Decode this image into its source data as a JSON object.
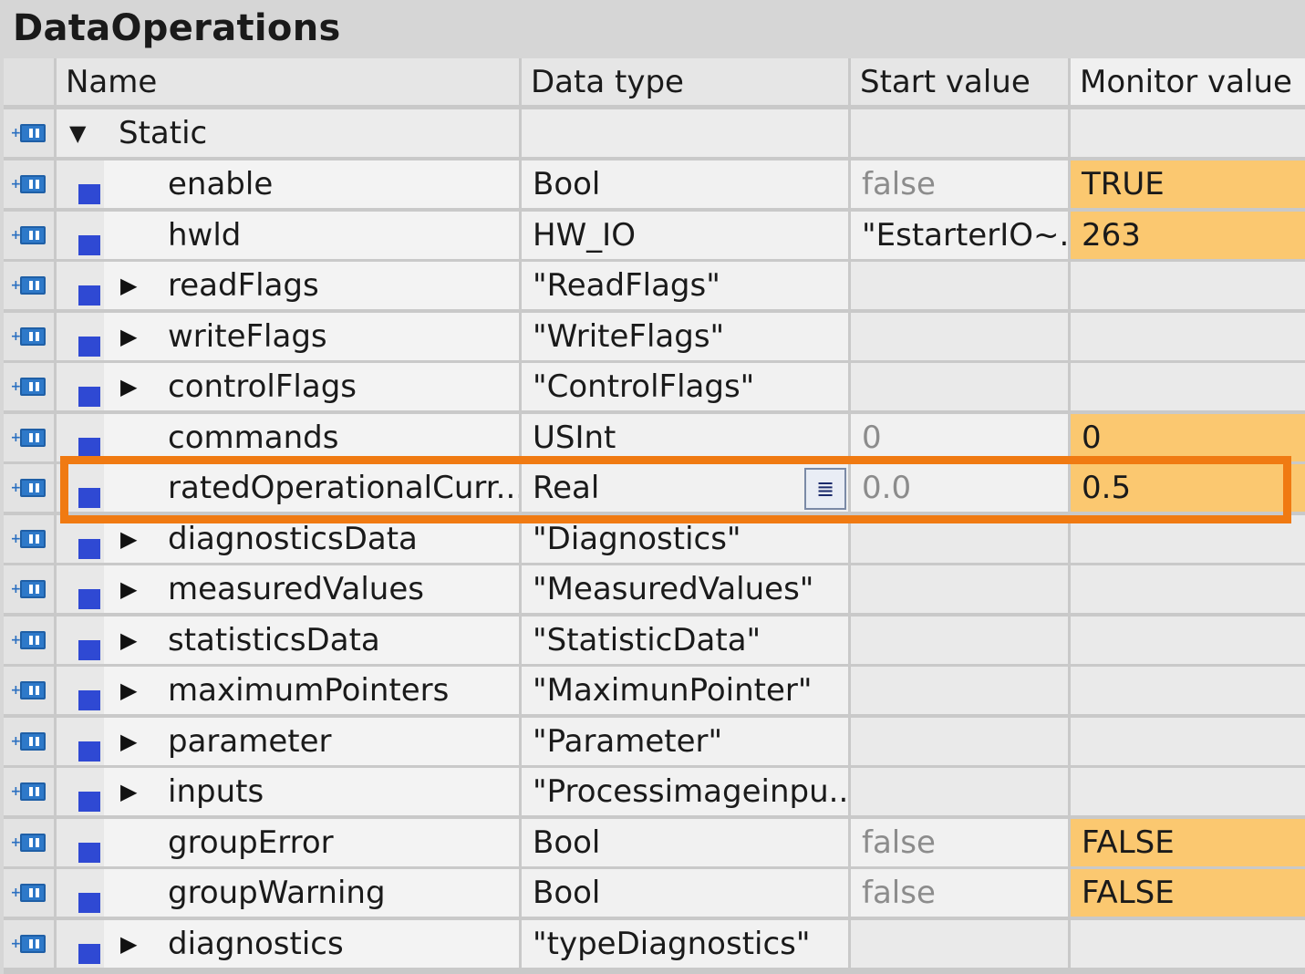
{
  "title": "DataOperations",
  "columns": {
    "name": "Name",
    "data_type": "Data type",
    "start_value": "Start value",
    "monitor_value": "Monitor value"
  },
  "colors": {
    "monitor_highlight": "#fbc870",
    "selection_border": "#f07a12",
    "variable_icon": "#2f49d3",
    "interface_icon": "#2e79c9"
  },
  "icons": {
    "interface": "interface-static-icon",
    "variable": "variable-icon",
    "expand": "expand-arrow-icon",
    "collapse": "collapse-arrow-icon",
    "list": "list-icon"
  },
  "static_section": {
    "label": "Static",
    "expanded": true
  },
  "rows": [
    {
      "name": "enable",
      "type": "Bool",
      "start": "false",
      "monitor": "TRUE",
      "expandable": false
    },
    {
      "name": "hwld",
      "type": "HW_IO",
      "start": "\"EstarterIO~...",
      "monitor": "263",
      "expandable": false
    },
    {
      "name": "readFlags",
      "type": "\"ReadFlags\"",
      "start": "",
      "monitor": "",
      "expandable": true
    },
    {
      "name": "writeFlags",
      "type": "\"WriteFlags\"",
      "start": "",
      "monitor": "",
      "expandable": true
    },
    {
      "name": "controlFlags",
      "type": "\"ControlFlags\"",
      "start": "",
      "monitor": "",
      "expandable": true
    },
    {
      "name": "commands",
      "type": "USInt",
      "start": "0",
      "monitor": "0",
      "expandable": false
    },
    {
      "name": "ratedOperationalCurr...",
      "type": "Real",
      "start": "0.0",
      "monitor": "0.5",
      "expandable": false,
      "selected": true
    },
    {
      "name": "diagnosticsData",
      "type": "\"Diagnostics\"",
      "start": "",
      "monitor": "",
      "expandable": true
    },
    {
      "name": "measuredValues",
      "type": "\"MeasuredValues\"",
      "start": "",
      "monitor": "",
      "expandable": true
    },
    {
      "name": "statisticsData",
      "type": "\"StatisticData\"",
      "start": "",
      "monitor": "",
      "expandable": true
    },
    {
      "name": "maximumPointers",
      "type": "\"MaximunPointer\"",
      "start": "",
      "monitor": "",
      "expandable": true
    },
    {
      "name": "parameter",
      "type": "\"Parameter\"",
      "start": "",
      "monitor": "",
      "expandable": true
    },
    {
      "name": "inputs",
      "type": "\"Processimageinpu...",
      "start": "",
      "monitor": "",
      "expandable": true
    },
    {
      "name": "groupError",
      "type": "Bool",
      "start": "false",
      "monitor": "FALSE",
      "expandable": false
    },
    {
      "name": "groupWarning",
      "type": "Bool",
      "start": "false",
      "monitor": "FALSE",
      "expandable": false
    },
    {
      "name": "diagnostics",
      "type": "\"typeDiagnostics\"",
      "start": "",
      "monitor": "",
      "expandable": true
    }
  ]
}
